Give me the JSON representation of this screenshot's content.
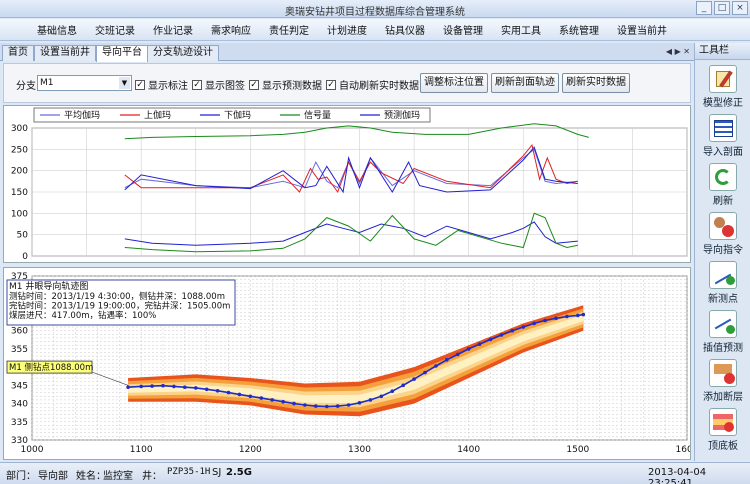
{
  "window": {
    "title": "奥瑞安钻井项目过程数据库综合管理系统"
  },
  "menu": [
    "基础信息",
    "交班记录",
    "作业记录",
    "需求响应",
    "责任判定",
    "计划进度",
    "钻具仪器",
    "设备管理",
    "实用工具",
    "系统管理",
    "设置当前井"
  ],
  "tabs": [
    "首页",
    "设置当前井",
    "导向平台",
    "分支轨迹设计"
  ],
  "active_tab": "导向平台",
  "controls": {
    "branch_label": "分支",
    "branch_value": "M1",
    "checkboxes": [
      {
        "label": "显示标注",
        "checked": true
      },
      {
        "label": "显示图签",
        "checked": true
      },
      {
        "label": "显示预测数据",
        "checked": true
      },
      {
        "label": "自动刷新实时数据",
        "checked": true
      }
    ],
    "buttons": [
      "调整标注位置",
      "刷新剖面轨迹",
      "刷新实时数据"
    ]
  },
  "toolbox": {
    "title": "工具栏",
    "items": [
      {
        "label": "模型修正",
        "icon": "edit-model-icon"
      },
      {
        "label": "导入剖面",
        "icon": "import-table-icon"
      },
      {
        "label": "刷新",
        "icon": "refresh-icon"
      },
      {
        "label": "导向指令",
        "icon": "steering-command-icon"
      },
      {
        "label": "新测点",
        "icon": "new-survey-point-icon"
      },
      {
        "label": "插值预测",
        "icon": "interpolation-icon"
      },
      {
        "label": "添加断层",
        "icon": "add-fault-icon"
      },
      {
        "label": "顶底板",
        "icon": "roof-floor-icon"
      }
    ]
  },
  "status": {
    "dept_label": "部门：",
    "dept_value": "导向部",
    "name_label": "姓名：",
    "name_value": "监控室",
    "well_label": "井：",
    "well_value": "PZP35-1H",
    "sj": "SJ",
    "version": "2.5G",
    "datetime": "2013-04-04 23:25:41"
  },
  "chart_data": [
    {
      "type": "line",
      "ylim": [
        0,
        300
      ],
      "yticks": [
        0,
        50,
        100,
        150,
        200,
        250,
        300
      ],
      "xlim": [
        1000,
        1600
      ],
      "grid": true,
      "legend_position": "top",
      "series": [
        {
          "name": "平均伽玛",
          "color": "#6a6adf",
          "x": [
            1085,
            1100,
            1150,
            1200,
            1230,
            1250,
            1260,
            1270,
            1280,
            1290,
            1300,
            1310,
            1330,
            1350,
            1380,
            1420,
            1450,
            1460,
            1470,
            1480,
            1500
          ],
          "values": [
            160,
            180,
            165,
            160,
            175,
            160,
            220,
            175,
            160,
            220,
            170,
            230,
            165,
            200,
            170,
            165,
            230,
            250,
            175,
            170,
            175
          ]
        },
        {
          "name": "上伽玛",
          "color": "#e02020",
          "x": [
            1085,
            1100,
            1150,
            1200,
            1230,
            1245,
            1255,
            1262,
            1270,
            1280,
            1290,
            1300,
            1310,
            1320,
            1340,
            1350,
            1380,
            1420,
            1450,
            1458,
            1465,
            1472,
            1480,
            1490,
            1500
          ],
          "values": [
            190,
            160,
            160,
            160,
            190,
            150,
            205,
            180,
            185,
            150,
            220,
            175,
            220,
            195,
            170,
            205,
            175,
            160,
            235,
            260,
            180,
            230,
            180,
            170,
            175
          ]
        },
        {
          "name": "下伽玛",
          "color": "#2020d0",
          "x": [
            1085,
            1100,
            1150,
            1200,
            1230,
            1250,
            1260,
            1270,
            1285,
            1290,
            1300,
            1310,
            1330,
            1345,
            1355,
            1380,
            1420,
            1450,
            1460,
            1470,
            1480,
            1500
          ],
          "values": [
            155,
            190,
            165,
            158,
            200,
            160,
            165,
            210,
            150,
            230,
            160,
            230,
            150,
            220,
            165,
            150,
            155,
            225,
            255,
            180,
            175,
            170
          ]
        },
        {
          "name": "信号量",
          "color": "#1a8a1a",
          "x": [
            1085,
            1110,
            1150,
            1200,
            1230,
            1250,
            1270,
            1290,
            1310,
            1330,
            1360,
            1400,
            1430,
            1460,
            1480,
            1500,
            1510
          ],
          "values": [
            275,
            278,
            280,
            282,
            285,
            290,
            300,
            305,
            300,
            290,
            285,
            285,
            300,
            310,
            305,
            285,
            278
          ]
        },
        {
          "name": "预测伽玛",
          "color": "#2020d0",
          "x": [
            1085,
            1110,
            1150,
            1200,
            1230,
            1250,
            1270,
            1285,
            1300,
            1320,
            1340,
            1360,
            1380,
            1400,
            1420,
            1440,
            1450,
            1460,
            1470,
            1480,
            1500
          ],
          "values": [
            40,
            30,
            25,
            30,
            35,
            55,
            75,
            65,
            55,
            75,
            65,
            45,
            70,
            55,
            40,
            55,
            65,
            80,
            45,
            30,
            35
          ]
        },
        {
          "name": "",
          "color": "#1a8a1a",
          "x": [
            1085,
            1110,
            1150,
            1200,
            1230,
            1250,
            1270,
            1290,
            1310,
            1330,
            1350,
            1370,
            1390,
            1410,
            1430,
            1450,
            1460,
            1470,
            1480,
            1490,
            1500
          ],
          "values": [
            20,
            15,
            10,
            12,
            18,
            40,
            90,
            70,
            35,
            95,
            40,
            25,
            60,
            45,
            30,
            20,
            100,
            90,
            30,
            20,
            25
          ]
        }
      ]
    },
    {
      "type": "line",
      "xlim": [
        1000,
        1600
      ],
      "ylim": [
        330,
        375
      ],
      "xticks": [
        1000,
        1100,
        1200,
        1300,
        1400,
        1500,
        1600
      ],
      "yticks": [
        330,
        335,
        340,
        345,
        350,
        355,
        360,
        365,
        370,
        375
      ],
      "grid": true,
      "info_box": {
        "title": "M1 井眼导向轨迹图",
        "lines": [
          "测钻时间：2013/1/19  4:30:00，侧钻井深：1088.00m",
          "完钻时间：2013/1/19  19:00:00，完钻井深：1505.00m",
          "煤层进尺：417.00m，钻遇率：100%"
        ]
      },
      "annotation": {
        "text": "M1 侧钻点1088.00m",
        "x": 1088,
        "y": 345
      },
      "band": {
        "x": [
          1088,
          1150,
          1200,
          1250,
          1300,
          1350,
          1400,
          1450,
          1505
        ],
        "top": [
          347,
          348,
          347,
          345.5,
          346,
          350,
          356,
          362,
          367
        ],
        "bottom": [
          340.5,
          340.5,
          339.5,
          337,
          336.5,
          340,
          347,
          354,
          360
        ]
      },
      "series": [
        {
          "name": "",
          "color": "#1e2ccc",
          "x": [
            1088,
            1100,
            1110,
            1120,
            1130,
            1140,
            1150,
            1160,
            1170,
            1180,
            1190,
            1200,
            1210,
            1220,
            1230,
            1240,
            1250,
            1260,
            1270,
            1280,
            1290,
            1300,
            1310,
            1320,
            1330,
            1340,
            1350,
            1360,
            1370,
            1380,
            1390,
            1400,
            1410,
            1420,
            1430,
            1440,
            1450,
            1460,
            1470,
            1480,
            1490,
            1500,
            1505
          ],
          "values": [
            344.5,
            344.7,
            344.8,
            344.9,
            344.7,
            344.5,
            344.3,
            343.9,
            343.5,
            343,
            342.5,
            342,
            341.5,
            341,
            340.5,
            340,
            339.6,
            339.3,
            339.2,
            339.3,
            339.6,
            340.2,
            341,
            342,
            343.4,
            345,
            346.7,
            348.5,
            350.3,
            352,
            353.5,
            355,
            356.3,
            357.6,
            358.8,
            360,
            361,
            362,
            362.8,
            363.4,
            363.9,
            364.2,
            364.4
          ]
        }
      ]
    }
  ]
}
